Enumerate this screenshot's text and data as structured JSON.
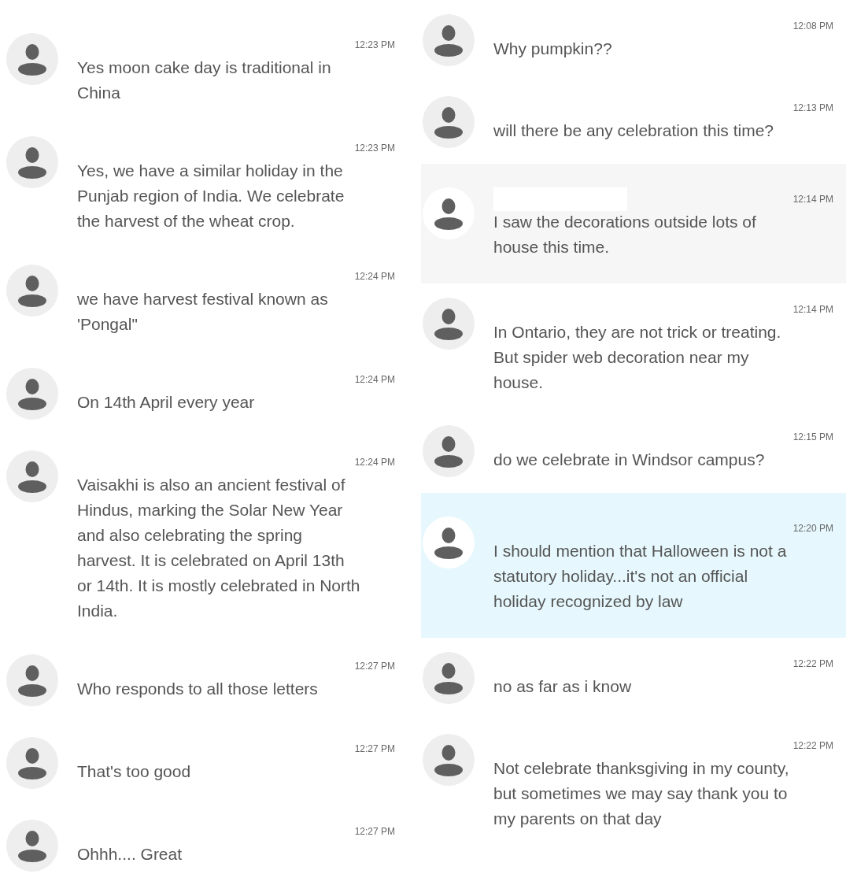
{
  "columns": [
    {
      "messages": [
        {
          "time": "12:23 PM",
          "text": "Yes moon cake day is traditional in China",
          "kind": "plain",
          "name_hidden": false
        },
        {
          "time": "12:23 PM",
          "text": "Yes, we have a similar holiday in the Punjab region of India. We celebrate the harvest of the wheat crop.",
          "kind": "plain",
          "name_hidden": false
        },
        {
          "time": "12:24 PM",
          "text": "we have harvest festival known as 'Pongal\"",
          "kind": "plain",
          "name_hidden": false
        },
        {
          "time": "12:24 PM",
          "text": "On 14th April every year",
          "kind": "plain",
          "name_hidden": false
        },
        {
          "time": "12:24 PM",
          "text": "Vaisakhi is also an ancient festival of Hindus, marking the Solar New Year and also celebrating the spring harvest. It is celebrated on April 13th or 14th. It is mostly celebrated in North India.",
          "kind": "plain",
          "name_hidden": false
        },
        {
          "time": "12:27 PM",
          "text": "Who responds to all those letters",
          "kind": "plain",
          "name_hidden": false
        },
        {
          "time": "12:27 PM",
          "text": "That's too good",
          "kind": "plain",
          "name_hidden": false
        },
        {
          "time": "12:27 PM",
          "text": "Ohhh.... Great",
          "kind": "plain",
          "name_hidden": false
        }
      ]
    },
    {
      "messages": [
        {
          "time": "12:08 PM",
          "text": "Why pumpkin??",
          "kind": "plain",
          "name_hidden": false
        },
        {
          "time": "12:13 PM",
          "text": "will there be any celebration this time?",
          "kind": "plain",
          "name_hidden": false
        },
        {
          "time": "12:14 PM",
          "text": "I saw the decorations outside lots of house this time.",
          "kind": "gray",
          "name_hidden": true
        },
        {
          "time": "12:14 PM",
          "text": "In Ontario, they are not trick or treating. But spider web decoration near my house.",
          "kind": "plain",
          "name_hidden": false
        },
        {
          "time": "12:15 PM",
          "text": "do we celebrate in Windsor campus?",
          "kind": "plain",
          "name_hidden": false
        },
        {
          "time": "12:20 PM",
          "text": "I should mention that Halloween is not a statutory holiday...it's not an official holiday recognized by law",
          "kind": "blue",
          "name_hidden": false
        },
        {
          "time": "12:22 PM",
          "text": "no as far as i know",
          "kind": "plain",
          "name_hidden": false
        },
        {
          "time": "12:22 PM",
          "text": "Not celebrate thanksgiving in my county, but sometimes we may say thank you to my parents on that day",
          "kind": "plain",
          "name_hidden": false
        }
      ]
    }
  ]
}
